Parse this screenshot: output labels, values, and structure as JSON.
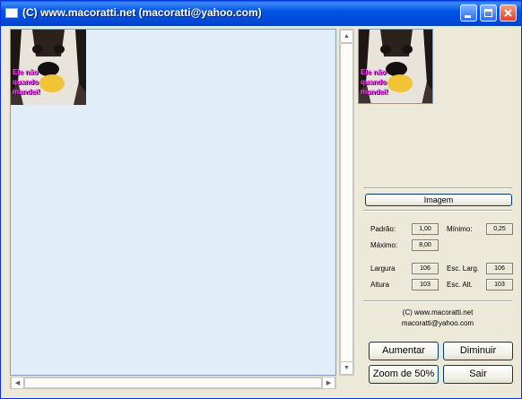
{
  "window": {
    "title": "(C) www.macoratti.net (macoratti@yahoo.com)"
  },
  "image": {
    "caption": "Ele não quando mandei!",
    "icon": "dog-photo"
  },
  "panel": {
    "imagem_label": "Imagem",
    "padrao_label": "Padrão:",
    "padrao_value": "1,00",
    "minimo_label": "Mínimo:",
    "minimo_value": "0,25",
    "maximo_label": "Máximo:",
    "maximo_value": "8,00",
    "largura_label": "Largura",
    "largura_value": "106",
    "esc_larg_label": "Esc. Larg.",
    "esc_larg_value": "106",
    "altura_label": "Altura",
    "altura_value": "103",
    "esc_alt_label": "Esc. Alt.",
    "esc_alt_value": "103",
    "credit_site": "(C) www.macoratti.net",
    "credit_email": "macoratti@yahoo.com"
  },
  "buttons": {
    "aumentar": "Aumentar",
    "diminuir": "Diminuir",
    "zoom": "Zoom de  50%",
    "sair": "Sair"
  },
  "colors": {
    "titlebar": "#0055e5",
    "picture_bg": "#e1edf9",
    "window_bg": "#ece9d8"
  }
}
